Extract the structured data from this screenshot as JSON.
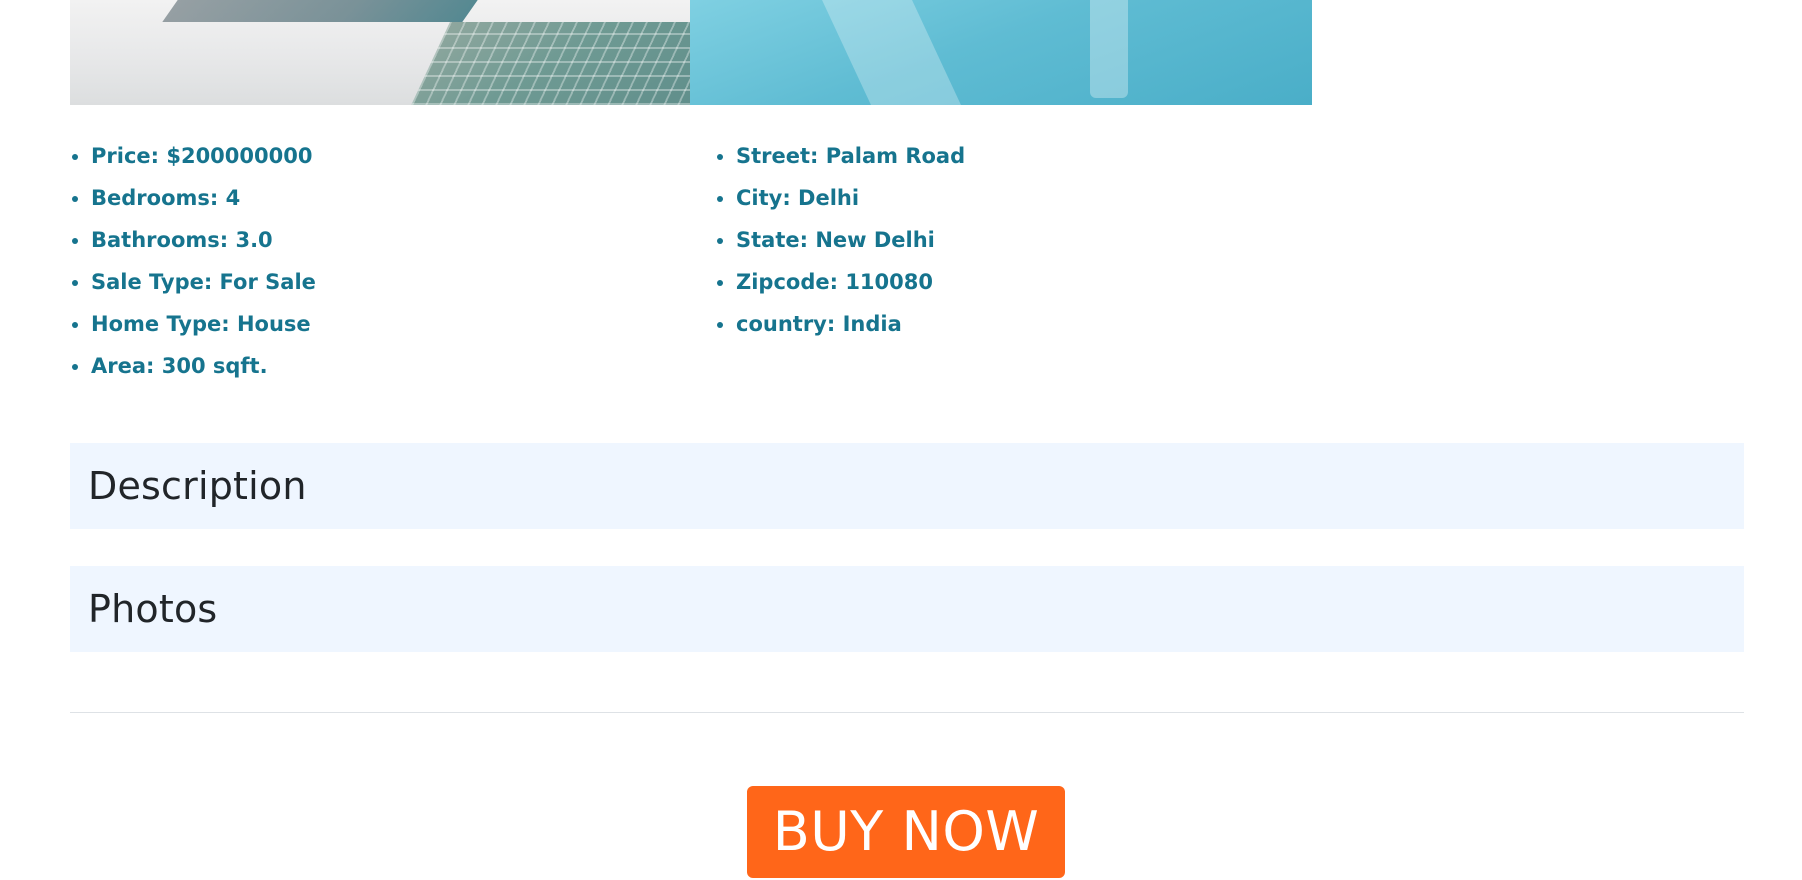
{
  "colors": {
    "list_text": "#16748e",
    "section_bg": "#eff6ff",
    "heading_text": "#212529",
    "buy_button_bg": "#ff6619",
    "buy_button_text": "#ffffff"
  },
  "hero_image": {
    "subject": "pool-image"
  },
  "property_details": [
    "Price: $200000000",
    "Bedrooms: 4",
    "Bathrooms: 3.0",
    "Sale Type: For Sale",
    "Home Type: House",
    "Area: 300 sqft."
  ],
  "address_details": [
    "Street: Palam Road",
    "City: Delhi",
    "State: New Delhi",
    "Zipcode: 110080",
    "country: India"
  ],
  "sections": {
    "description": "Description",
    "photos": "Photos"
  },
  "buy_button_label": "BUY NOW"
}
